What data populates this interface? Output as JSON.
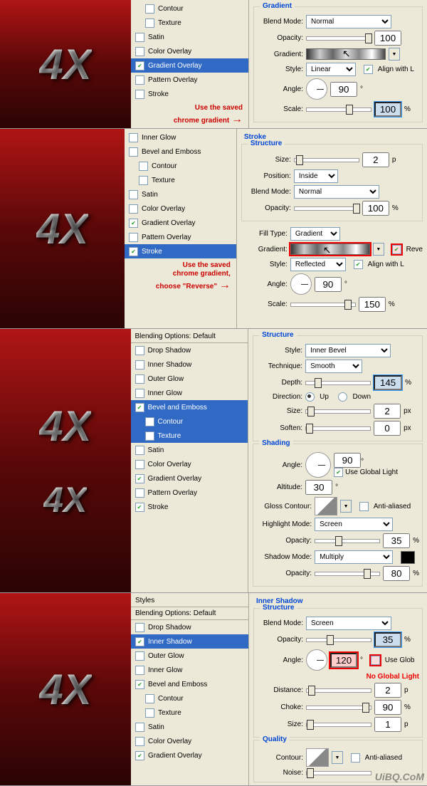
{
  "logo_text": "4X",
  "sec1": {
    "styles": [
      {
        "label": "Contour",
        "checked": false,
        "sub": true
      },
      {
        "label": "Texture",
        "checked": false,
        "sub": true
      },
      {
        "label": "Satin",
        "checked": false
      },
      {
        "label": "Color Overlay",
        "checked": false
      },
      {
        "label": "Gradient Overlay",
        "checked": true,
        "selected": true
      },
      {
        "label": "Pattern Overlay",
        "checked": false
      },
      {
        "label": "Stroke",
        "checked": false
      }
    ],
    "note_line1": "Use the saved",
    "note_line2": "chrome gradient",
    "group": "Gradient",
    "blend_label": "Blend Mode:",
    "blend_val": "Normal",
    "opacity_label": "Opacity:",
    "opacity_val": "100",
    "gradient_label": "Gradient:",
    "style_label": "Style:",
    "style_val": "Linear",
    "align_label": "Align with L",
    "angle_label": "Angle:",
    "angle_val": "90",
    "deg": "°",
    "scale_label": "Scale:",
    "scale_val": "100",
    "pct": "%"
  },
  "sec2": {
    "styles": [
      {
        "label": "Inner Glow",
        "checked": false
      },
      {
        "label": "Bevel and Emboss",
        "checked": false
      },
      {
        "label": "Contour",
        "checked": false,
        "sub": true
      },
      {
        "label": "Texture",
        "checked": false,
        "sub": true
      },
      {
        "label": "Satin",
        "checked": false
      },
      {
        "label": "Color Overlay",
        "checked": false
      },
      {
        "label": "Gradient Overlay",
        "checked": true
      },
      {
        "label": "Pattern Overlay",
        "checked": false
      },
      {
        "label": "Stroke",
        "checked": true,
        "selected": true
      }
    ],
    "note_line1": "Use the saved",
    "note_line2": "chrome gradient,",
    "note_line3": "choose \"Reverse\"",
    "group_stroke": "Stroke",
    "group_struct": "Structure",
    "size_label": "Size:",
    "size_val": "2",
    "px": "p",
    "position_label": "Position:",
    "position_val": "Inside",
    "blend_label": "Blend Mode:",
    "blend_val": "Normal",
    "opacity_label": "Opacity:",
    "opacity_val": "100",
    "pct": "%",
    "filltype_label": "Fill Type:",
    "filltype_val": "Gradient",
    "gradient_label": "Gradient:",
    "reverse_label": "Reve",
    "style_label": "Style:",
    "style_val": "Reflected",
    "align_label": "Align with L",
    "angle_label": "Angle:",
    "angle_val": "90",
    "deg": "°",
    "scale_label": "Scale:",
    "scale_val": "150"
  },
  "sec3": {
    "header": "Blending Options: Default",
    "styles": [
      {
        "label": "Drop Shadow",
        "checked": false
      },
      {
        "label": "Inner Shadow",
        "checked": false
      },
      {
        "label": "Outer Glow",
        "checked": false
      },
      {
        "label": "Inner Glow",
        "checked": false
      },
      {
        "label": "Bevel and Emboss",
        "checked": true,
        "selected": true
      },
      {
        "label": "Contour",
        "checked": false,
        "sub": true,
        "selected": true
      },
      {
        "label": "Texture",
        "checked": false,
        "sub": true,
        "selected": true
      },
      {
        "label": "Satin",
        "checked": false
      },
      {
        "label": "Color Overlay",
        "checked": false
      },
      {
        "label": "Gradient Overlay",
        "checked": true
      },
      {
        "label": "Pattern Overlay",
        "checked": false
      },
      {
        "label": "Stroke",
        "checked": true
      }
    ],
    "group_struct": "Structure",
    "style_label": "Style:",
    "style_val": "Inner Bevel",
    "tech_label": "Technique:",
    "tech_val": "Smooth",
    "depth_label": "Depth:",
    "depth_val": "145",
    "pct": "%",
    "dir_label": "Direction:",
    "up": "Up",
    "down": "Down",
    "size_label": "Size:",
    "size_val": "2",
    "px": "px",
    "soften_label": "Soften:",
    "soften_val": "0",
    "group_shade": "Shading",
    "angle_label": "Angle:",
    "angle_val": "90",
    "deg": "°",
    "global_label": "Use Global Light",
    "alt_label": "Altitude:",
    "alt_val": "30",
    "gloss_label": "Gloss Contour:",
    "anti_label": "Anti-aliased",
    "hmode_label": "Highlight Mode:",
    "hmode_val": "Screen",
    "opacity_label": "Opacity:",
    "hop_val": "35",
    "smode_label": "Shadow Mode:",
    "smode_val": "Multiply",
    "sop_val": "80"
  },
  "sec4": {
    "styles_header": "Styles",
    "header": "Blending Options: Default",
    "styles": [
      {
        "label": "Drop Shadow",
        "checked": false
      },
      {
        "label": "Inner Shadow",
        "checked": true,
        "selected": true
      },
      {
        "label": "Outer Glow",
        "checked": false
      },
      {
        "label": "Inner Glow",
        "checked": false
      },
      {
        "label": "Bevel and Emboss",
        "checked": true
      },
      {
        "label": "Contour",
        "checked": false,
        "sub": true
      },
      {
        "label": "Texture",
        "checked": false,
        "sub": true
      },
      {
        "label": "Satin",
        "checked": false
      },
      {
        "label": "Color Overlay",
        "checked": false
      },
      {
        "label": "Gradient Overlay",
        "checked": true
      }
    ],
    "group_is": "Inner Shadow",
    "group_struct": "Structure",
    "blend_label": "Blend Mode:",
    "blend_val": "Screen",
    "opacity_label": "Opacity:",
    "opacity_val": "35",
    "pct": "%",
    "angle_label": "Angle:",
    "angle_val": "120",
    "deg": "°",
    "global_label": "Use Glob",
    "noglobal": "No Global Light",
    "dist_label": "Distance:",
    "dist_val": "2",
    "px": "p",
    "choke_label": "Choke:",
    "choke_val": "90",
    "size_label": "Size:",
    "size_val": "1",
    "group_q": "Quality",
    "contour_label": "Contour:",
    "anti_label": "Anti-aliased",
    "noise_label": "Noise:",
    "watermark": "UiBQ.CoM"
  }
}
